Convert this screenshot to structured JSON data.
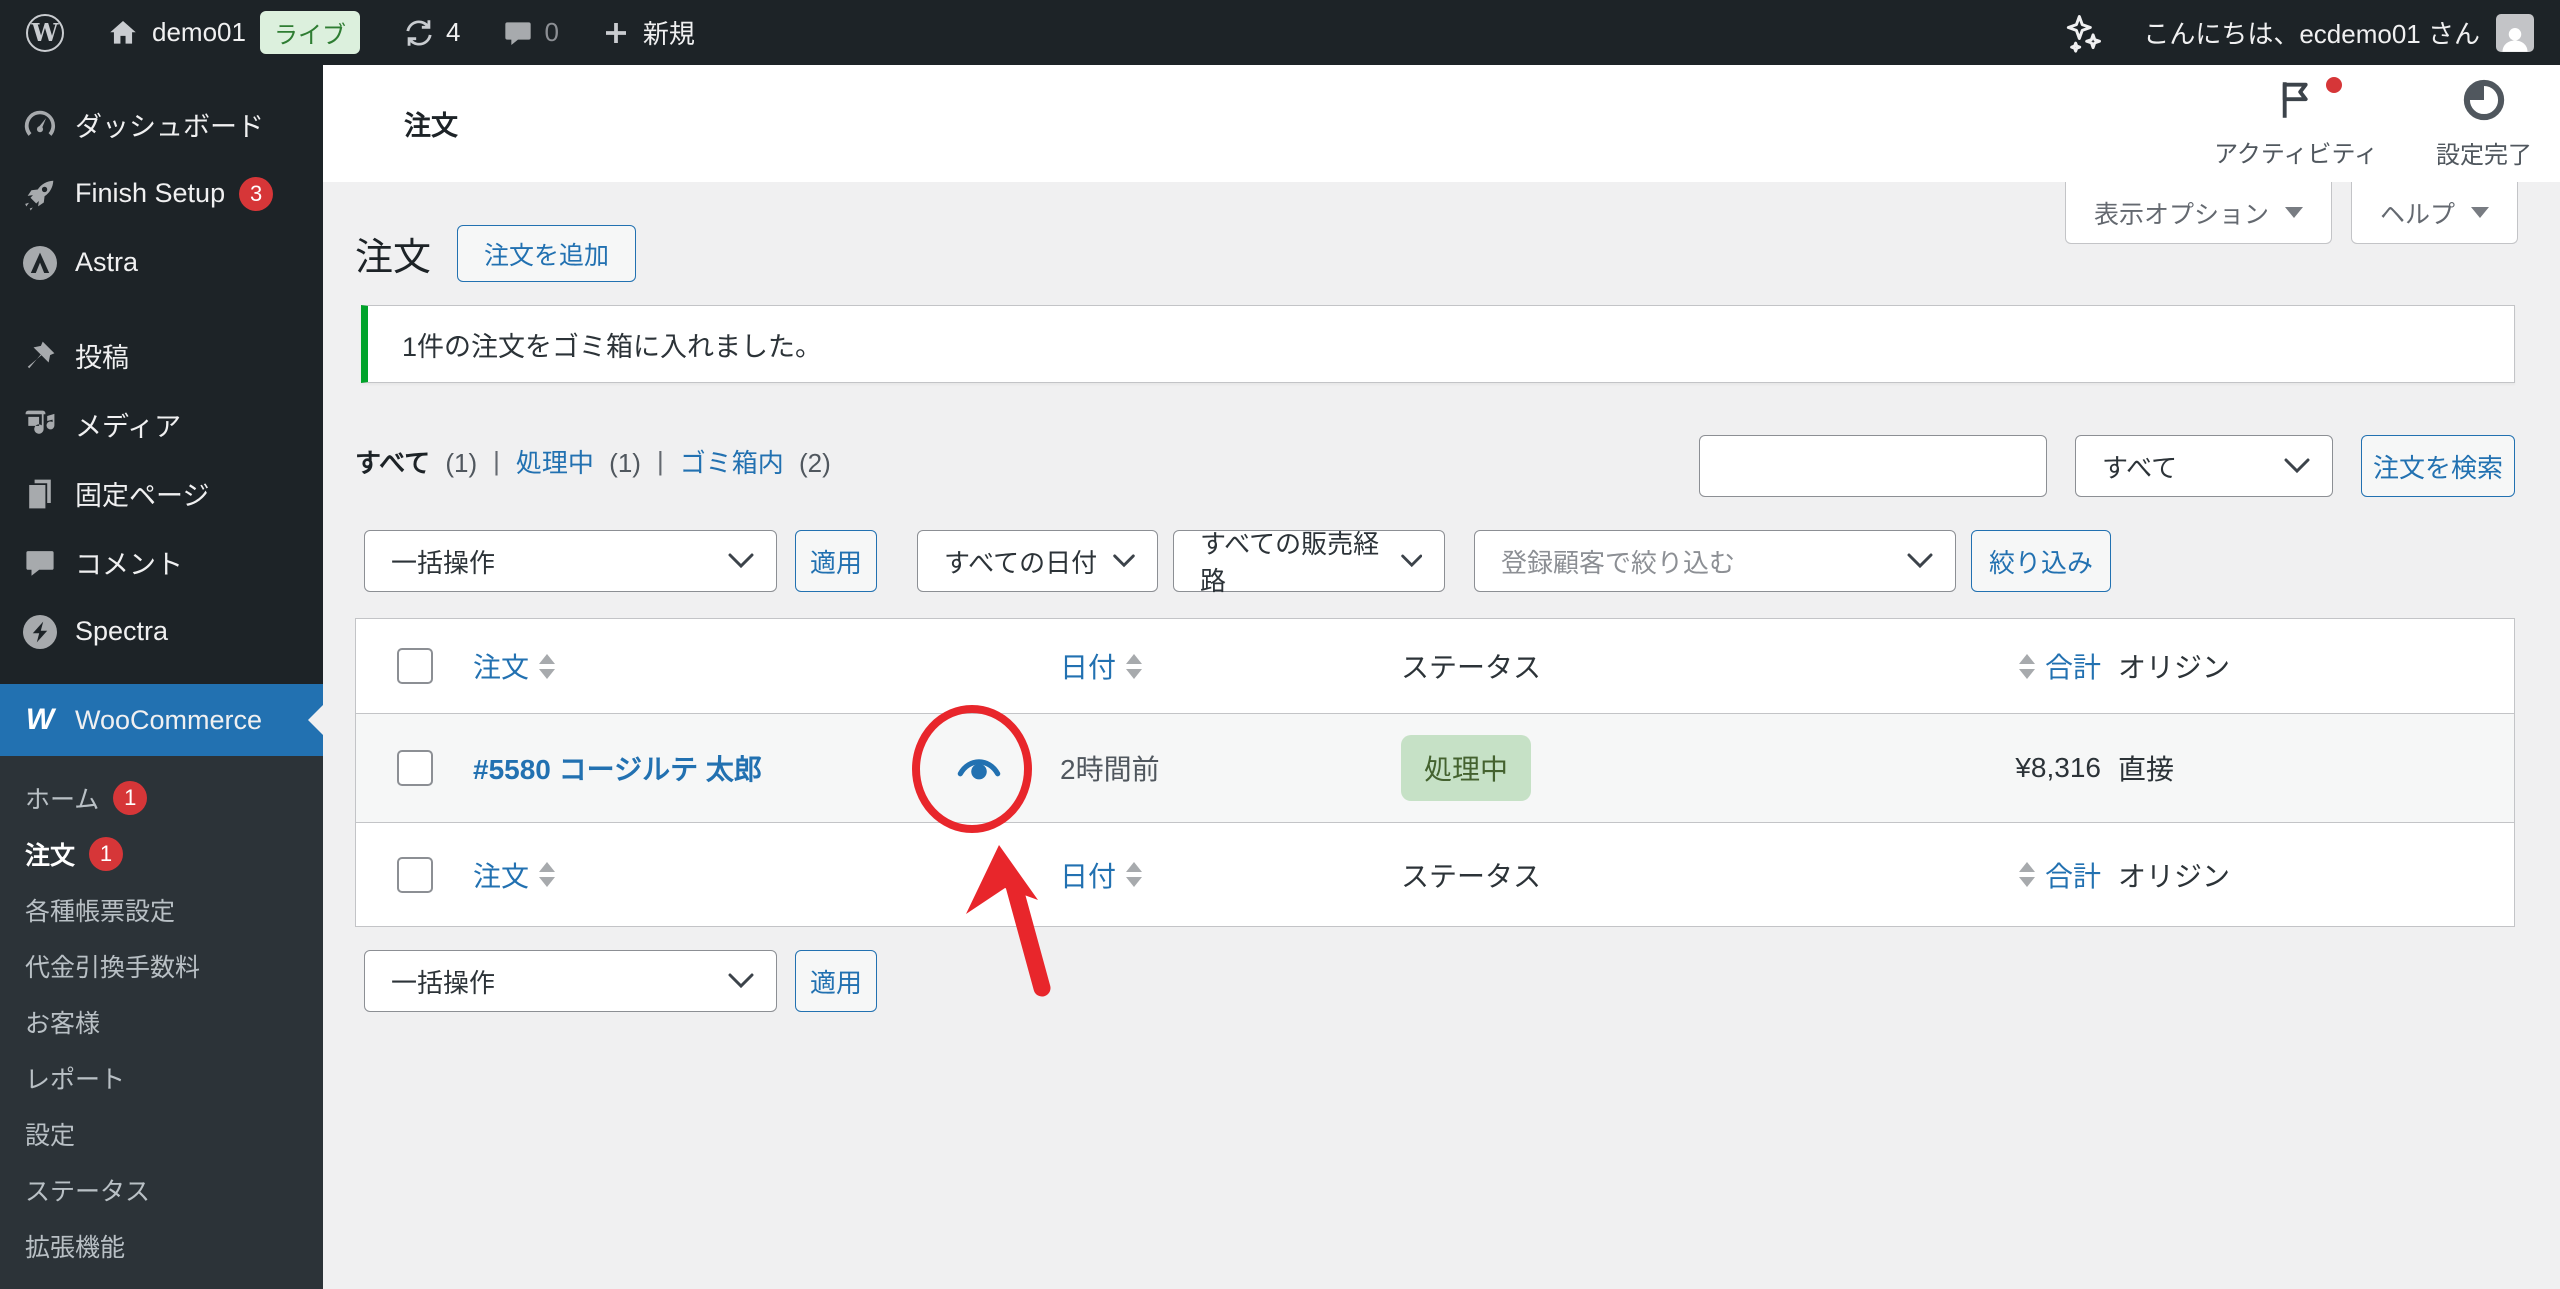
{
  "colors": {
    "accent_blue": "#2271b1",
    "admin_dark": "#1d2327",
    "submenu_bg": "#2c3338",
    "content_bg": "#f0f0f1",
    "border_gray": "#c3c4c7",
    "notice_green": "#00a32a",
    "badge_red": "#d63638",
    "live_badge_bg": "#dcf0dd",
    "live_badge_text": "#2e7d32",
    "status_processing_bg": "#c6e1c6",
    "status_processing_text": "#44622f",
    "annotation_red": "#e8262b"
  },
  "admin_bar": {
    "site_name": "demo01",
    "live_badge": "ライブ",
    "update_count": "4",
    "comment_count": "0",
    "new_label": "新規",
    "greeting": "こんにちは、ecdemo01 さん"
  },
  "sidebar": {
    "items": [
      {
        "label": "ダッシュボード",
        "icon": "dashboard-icon"
      },
      {
        "label": "Finish Setup",
        "icon": "rocket-icon",
        "badge": "3"
      },
      {
        "label": "Astra",
        "icon": "astra-icon"
      },
      {
        "label": "投稿",
        "icon": "pushpin-icon"
      },
      {
        "label": "メディア",
        "icon": "media-icon"
      },
      {
        "label": "固定ページ",
        "icon": "pages-icon"
      },
      {
        "label": "コメント",
        "icon": "comment-icon"
      },
      {
        "label": "Spectra",
        "icon": "spectra-icon"
      },
      {
        "label": "WooCommerce",
        "icon": "woocommerce-icon"
      }
    ],
    "submenu": [
      {
        "label": "ホーム",
        "badge": "1"
      },
      {
        "label": "注文",
        "badge": "1"
      },
      {
        "label": "各種帳票設定"
      },
      {
        "label": "代金引換手数料"
      },
      {
        "label": "お客様"
      },
      {
        "label": "レポート"
      },
      {
        "label": "設定"
      },
      {
        "label": "ステータス"
      },
      {
        "label": "拡張機能"
      }
    ]
  },
  "content_header": {
    "title": "注文",
    "activity_label": "アクティビティ",
    "setup_label": "設定完了"
  },
  "screen_tabs": {
    "options_label": "表示オプション",
    "help_label": "ヘルプ"
  },
  "page": {
    "title": "注文",
    "add_order_button": "注文を追加",
    "notice": "1件の注文をゴミ箱に入れました。",
    "filters": [
      {
        "label": "すべて",
        "count": "(1)"
      },
      {
        "label": "処理中",
        "count": "(1)"
      },
      {
        "label": "ゴミ箱内",
        "count": "(2)"
      }
    ],
    "search": {
      "input_value": "",
      "type_select": "すべて",
      "button": "注文を検索"
    },
    "toolbar": {
      "bulk_select": "一括操作",
      "apply_button": "適用",
      "date_select": "すべての日付",
      "channel_select": "すべての販売経路",
      "customer_select_placeholder": "登録顧客で絞り込む",
      "filter_button": "絞り込み"
    }
  },
  "table": {
    "columns": {
      "order": "注文",
      "date": "日付",
      "status": "ステータス",
      "total": "合計",
      "origin": "オリジン"
    },
    "rows": [
      {
        "order": "#5580 コージルテ 太郎",
        "date": "2時間前",
        "status": "処理中",
        "total": "¥8,316",
        "origin": "直接"
      }
    ]
  },
  "annotation": {
    "shape": "circle-and-arrow",
    "target": "order-preview-eye",
    "color": "#e8262b"
  }
}
